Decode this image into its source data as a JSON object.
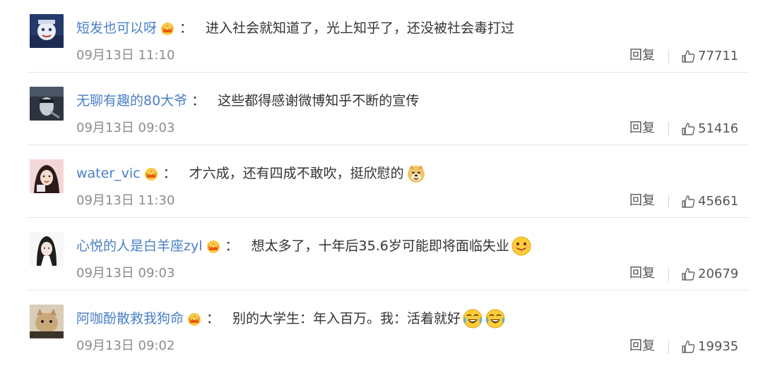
{
  "comments": [
    {
      "username": "短发也可以呀",
      "vip_icon": "crown-badge-icon",
      "separator": "：",
      "text": "进入社会就知道了，光上知乎了，还没被社会毒打过",
      "emojis": [],
      "timestamp": "09月13日 11:10",
      "reply_label": "回复",
      "like_icon": "thumbs-up-icon",
      "likes": "77711"
    },
    {
      "username": "无聊有趣的80大爷",
      "vip_icon": null,
      "separator": "：",
      "text": "这些都得感谢微博知乎不断的宣传",
      "emojis": [],
      "timestamp": "09月13日 09:03",
      "reply_label": "回复",
      "like_icon": "thumbs-up-icon",
      "likes": "51416"
    },
    {
      "username": "water_vic",
      "vip_icon": "crown-badge-icon",
      "separator": "：",
      "text": "才六成，还有四成不敢吹，挺欣慰的",
      "emojis": [
        "doge-emoji-icon"
      ],
      "timestamp": "09月13日 11:30",
      "reply_label": "回复",
      "like_icon": "thumbs-up-icon",
      "likes": "45661"
    },
    {
      "username": "心悦的人是白羊座zyl",
      "vip_icon": "crown-badge-icon",
      "separator": "：",
      "text": "想太多了，十年后35.6岁可能即将面临失业",
      "emojis": [
        "tongue-out-emoji-icon"
      ],
      "timestamp": "09月13日 09:03",
      "reply_label": "回复",
      "like_icon": "thumbs-up-icon",
      "likes": "20679"
    },
    {
      "username": "阿咖酚散救我狗命",
      "vip_icon": "crown-badge-icon",
      "separator": "：",
      "text": "别的大学生：年入百万。我：活着就好",
      "emojis": [
        "laugh-cry-emoji-icon",
        "laugh-cry-emoji-icon"
      ],
      "timestamp": "09月13日 09:02",
      "reply_label": "回复",
      "like_icon": "thumbs-up-icon",
      "likes": "19935"
    }
  ],
  "colors": {
    "username": "#4a7fc6",
    "body_text": "#333333",
    "timestamp": "#8c8c8c",
    "action_text": "#555555",
    "divider": "#e6e6e6",
    "vip_crown": "#f5a623",
    "emoji_face": "#ffcd3c"
  }
}
